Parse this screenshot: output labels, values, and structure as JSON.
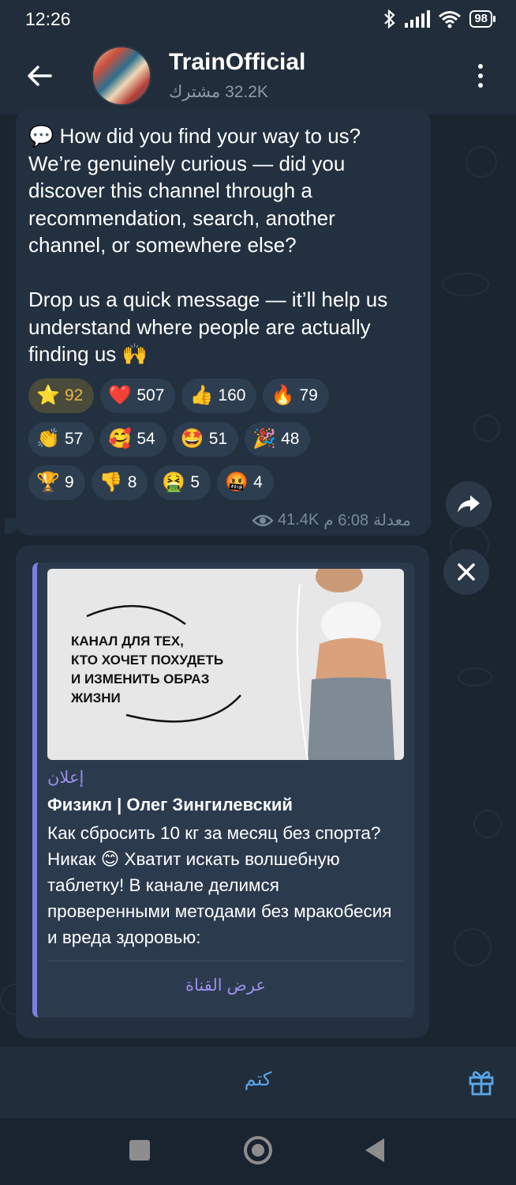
{
  "status_bar": {
    "time": "12:26",
    "battery": "98"
  },
  "header": {
    "title": "TrainOfficial",
    "subtitle": "32.2K مشترك"
  },
  "message": {
    "text": "💬 How did you find your way to us? We’re genuinely curious — did you discover this channel through a recommendation, search, another channel, or somewhere else?\n\nDrop us a quick message — it’ll help us understand where people are actually finding us 🙌",
    "reactions_rows": [
      [
        {
          "emoji": "⭐",
          "count": "92",
          "active": true
        },
        {
          "emoji": "❤️",
          "count": "507"
        },
        {
          "emoji": "👍",
          "count": "160"
        },
        {
          "emoji": "🔥",
          "count": "79"
        }
      ],
      [
        {
          "emoji": "👏",
          "count": "57"
        },
        {
          "emoji": "🥰",
          "count": "54"
        },
        {
          "emoji": "🤩",
          "count": "51"
        },
        {
          "emoji": "🎉",
          "count": "48"
        }
      ],
      [
        {
          "emoji": "🏆",
          "count": "9"
        },
        {
          "emoji": "👎",
          "count": "8"
        },
        {
          "emoji": "🤮",
          "count": "5"
        },
        {
          "emoji": "🤬",
          "count": "4"
        }
      ]
    ],
    "views": "41.4K",
    "time": "6:08 م",
    "edited": "معدلة"
  },
  "ad": {
    "image_text": "Канал для тех,\nкто хочет похудеть\nи изменить образ\nжизни",
    "label": "إعلان",
    "title": "Физикл | Олег Зингилевский",
    "body": "Как сбросить 10 кг за месяц без спорта? Никак 😊 Хватит искать волшебную таблетку! В канале делимся проверенными методами без мракобесия и вреда здоровью:",
    "cta": "عرض القناة"
  },
  "bottom": {
    "mute_label": "كتم"
  },
  "icons": {
    "back": "arrow-left-icon",
    "menu": "more-vertical-icon",
    "share": "share-icon",
    "close": "close-icon",
    "gift": "gift-icon",
    "eye": "eye-icon"
  },
  "colors": {
    "accent": "#5aa6e8",
    "ad_accent": "#7b7fe0",
    "reaction_active": "#e8b845"
  }
}
